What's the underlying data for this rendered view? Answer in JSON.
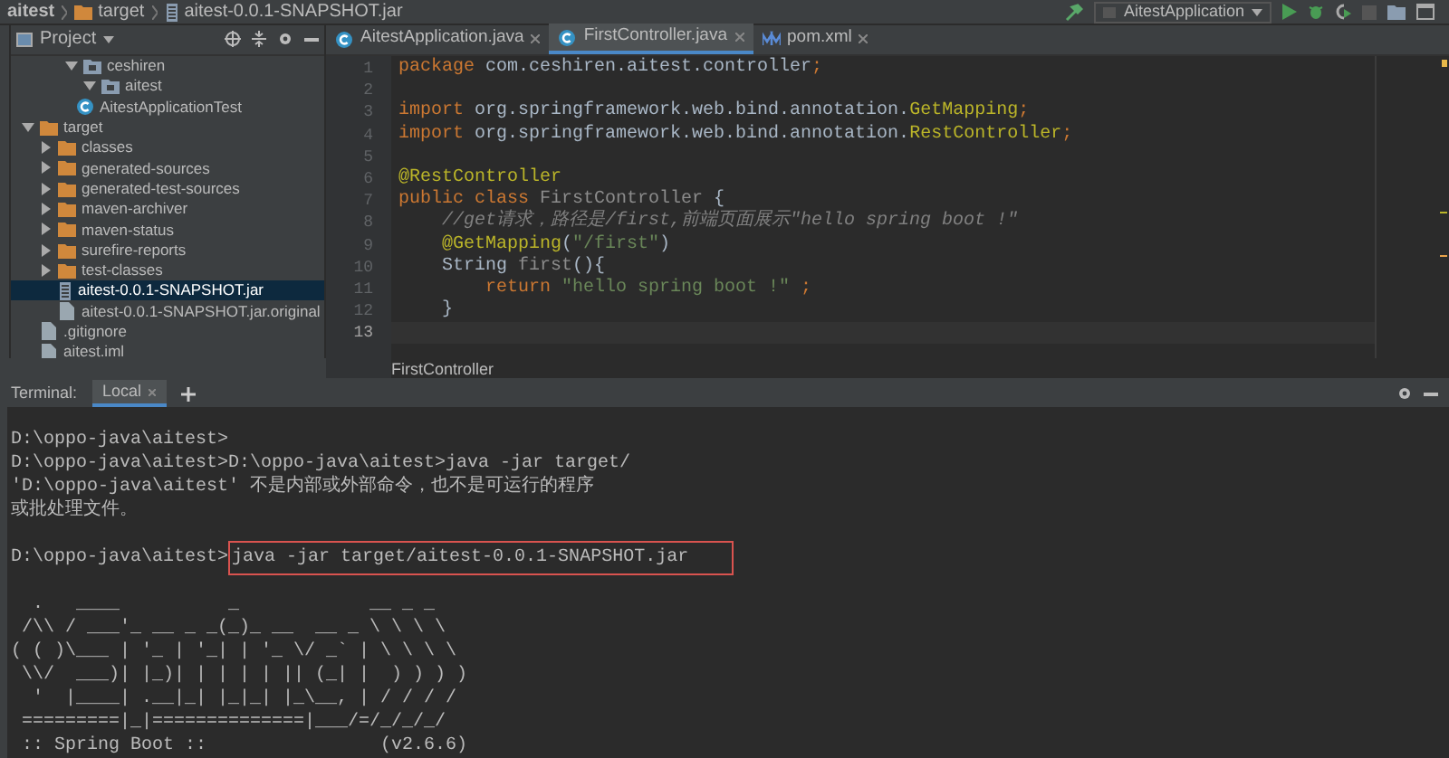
{
  "breadcrumbs": [
    {
      "label": "aitest",
      "kind": "project"
    },
    {
      "label": "target",
      "kind": "folder"
    },
    {
      "label": "aitest-0.0.1-SNAPSHOT.jar",
      "kind": "jar"
    }
  ],
  "run_config": "AitestApplication",
  "project_panel": {
    "title": "Project",
    "tree": [
      {
        "label": "ceshiren",
        "kind": "package",
        "expanded": true,
        "selected": false,
        "children": [
          {
            "label": "aitest",
            "kind": "package",
            "expanded": true,
            "selected": false,
            "children": [
              {
                "label": "AitestApplicationTest",
                "kind": "class",
                "selected": false
              }
            ]
          }
        ]
      },
      {
        "label": "target",
        "kind": "folder",
        "expanded": true,
        "selected": false,
        "children": [
          {
            "label": "classes",
            "kind": "folder",
            "expanded": false,
            "selected": false
          },
          {
            "label": "generated-sources",
            "kind": "folder",
            "expanded": false,
            "selected": false
          },
          {
            "label": "generated-test-sources",
            "kind": "folder",
            "expanded": false,
            "selected": false
          },
          {
            "label": "maven-archiver",
            "kind": "folder",
            "expanded": false,
            "selected": false
          },
          {
            "label": "maven-status",
            "kind": "folder",
            "expanded": false,
            "selected": false
          },
          {
            "label": "surefire-reports",
            "kind": "folder",
            "expanded": false,
            "selected": false
          },
          {
            "label": "test-classes",
            "kind": "folder",
            "expanded": false,
            "selected": false
          },
          {
            "label": "aitest-0.0.1-SNAPSHOT.jar",
            "kind": "jar",
            "selected": true
          },
          {
            "label": "aitest-0.0.1-SNAPSHOT.jar.original",
            "kind": "file",
            "selected": false
          }
        ]
      },
      {
        "label": ".gitignore",
        "kind": "file",
        "selected": false
      },
      {
        "label": "aitest.iml",
        "kind": "file",
        "selected": false
      }
    ]
  },
  "editor_tabs": [
    {
      "label": "AitestApplication.java",
      "kind": "class",
      "selected": false
    },
    {
      "label": "FirstController.java",
      "kind": "class",
      "selected": true
    },
    {
      "label": "pom.xml",
      "kind": "maven",
      "selected": false
    }
  ],
  "code_lines": [
    {
      "number": "1",
      "current": false,
      "tokens": [
        {
          "text": "package ",
          "kind": "keyword"
        },
        {
          "text": "com.ceshiren.aitest.controller",
          "kind": "plain"
        },
        {
          "text": ";",
          "kind": "keyword"
        }
      ]
    },
    {
      "number": "2",
      "current": false
    },
    {
      "number": "3",
      "current": false,
      "tokens": [
        {
          "text": "import ",
          "kind": "keyword"
        },
        {
          "text": "org.springframework.web.bind.annotation.",
          "kind": "plain"
        },
        {
          "text": "GetMapping",
          "kind": "annotation"
        },
        {
          "text": ";",
          "kind": "keyword"
        }
      ]
    },
    {
      "number": "4",
      "current": false,
      "tokens": [
        {
          "text": "import ",
          "kind": "keyword"
        },
        {
          "text": "org.springframework.web.bind.annotation.",
          "kind": "plain"
        },
        {
          "text": "RestController",
          "kind": "annotation"
        },
        {
          "text": ";",
          "kind": "keyword"
        }
      ]
    },
    {
      "number": "5",
      "current": false
    },
    {
      "number": "6",
      "current": false,
      "tokens": [
        {
          "text": "@RestController",
          "kind": "annotation"
        }
      ]
    },
    {
      "number": "7",
      "current": false,
      "tokens": [
        {
          "text": "public class ",
          "kind": "keyword"
        },
        {
          "text": "FirstController",
          "kind": "unused"
        },
        {
          "text": " {",
          "kind": "plain"
        }
      ]
    },
    {
      "number": "8",
      "current": false,
      "tokens": [
        {
          "text": "    //get请求，路径是/first,前端页面展示\"hello spring boot !\"",
          "kind": "comment"
        }
      ]
    },
    {
      "number": "9",
      "current": false,
      "tokens": [
        {
          "text": "    @GetMapping",
          "kind": "annotation"
        },
        {
          "text": "(",
          "kind": "plain"
        },
        {
          "text": "\"/first\"",
          "kind": "string"
        },
        {
          "text": ")",
          "kind": "plain"
        }
      ]
    },
    {
      "number": "10",
      "current": false,
      "tokens": [
        {
          "text": "    String ",
          "kind": "plain"
        },
        {
          "text": "first",
          "kind": "unused"
        },
        {
          "text": "(){",
          "kind": "plain"
        }
      ]
    },
    {
      "number": "11",
      "current": false,
      "tokens": [
        {
          "text": "        return ",
          "kind": "keyword"
        },
        {
          "text": "\"hello spring boot !\"",
          "kind": "string"
        },
        {
          "text": " ;",
          "kind": "keyword"
        }
      ]
    },
    {
      "number": "12",
      "current": false,
      "tokens": [
        {
          "text": "    }",
          "kind": "plain"
        }
      ]
    },
    {
      "number": "13",
      "current": true
    }
  ],
  "editor_breadcrumb": "FirstController",
  "terminal": {
    "title": "Terminal:",
    "tabs": [
      {
        "label": "Local",
        "selected": true
      }
    ],
    "blocks": [
      {
        "kind": "output",
        "lines": [
          "D:\\oppo-java\\aitest>",
          "D:\\oppo-java\\aitest>D:\\oppo-java\\aitest>java -jar target/",
          "'D:\\oppo-java\\aitest' 不是内部或外部命令，也不是可运行的程序",
          "或批处理文件。"
        ]
      },
      {
        "kind": "command",
        "prompt": "D:\\oppo-java\\aitest>",
        "command": "java -jar target/aitest-0.0.1-SNAPSHOT.jar",
        "boxed": true
      },
      {
        "kind": "output",
        "lines": [
          "  .   ____          _            __ _ _",
          " /\\\\ / ___'_ __ _ _(_)_ __  __ _ \\ \\ \\ \\",
          "( ( )\\___ | '_ | '_| | '_ \\/ _` | \\ \\ \\ \\",
          " \\\\/  ___)| |_)| | | | | || (_| |  ) ) ) )",
          "  '  |____| .__|_| |_|_| |_\\__, | / / / /",
          " =========|_|==============|___/=/_/_/_/",
          " :: Spring Boot ::                (v2.6.6)"
        ]
      }
    ]
  }
}
